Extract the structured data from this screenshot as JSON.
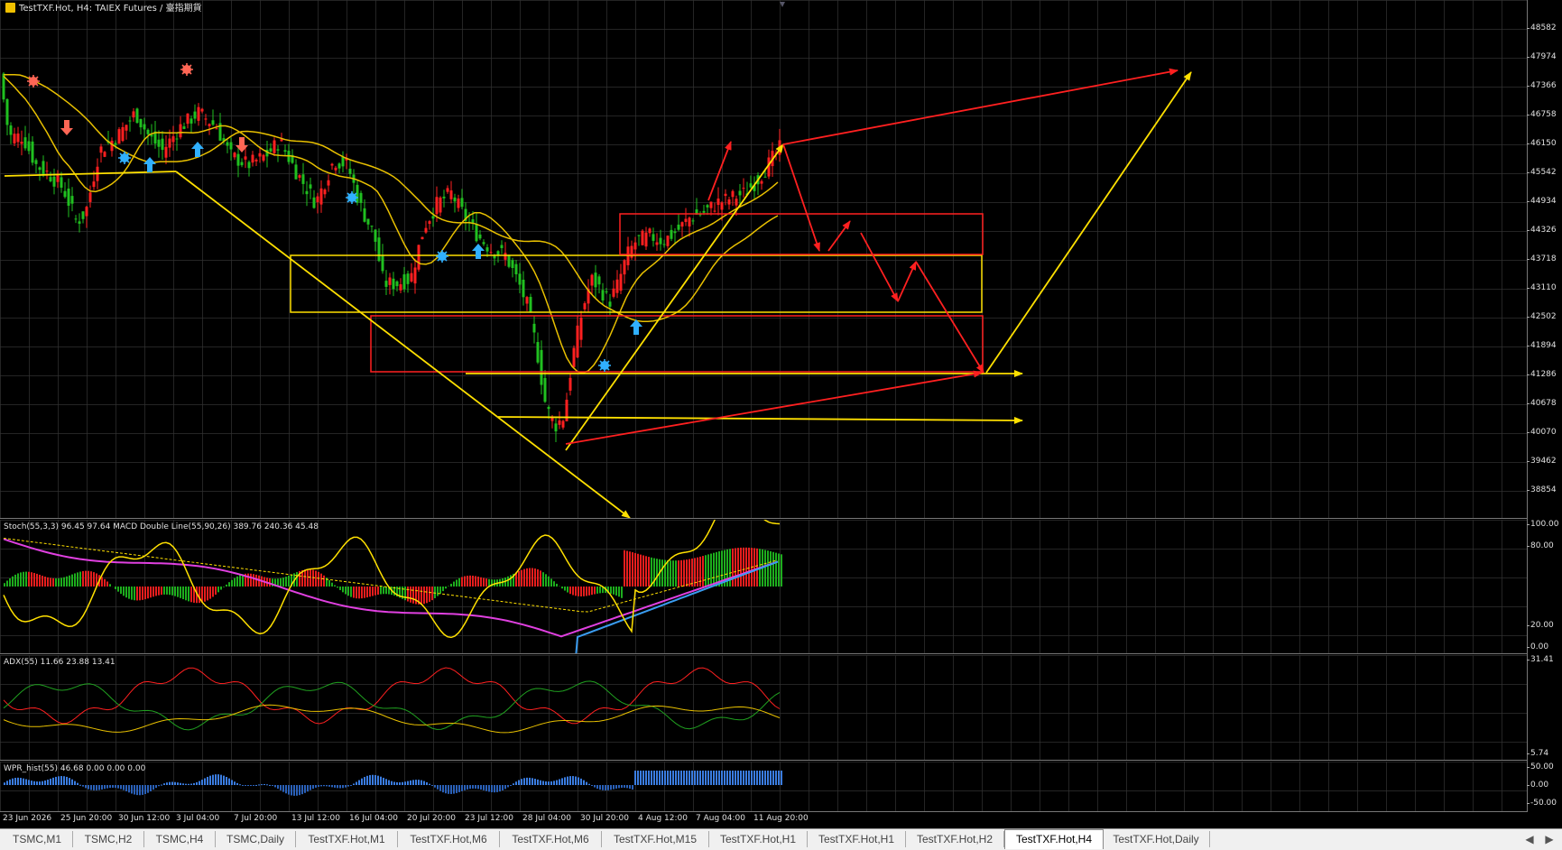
{
  "chart": {
    "title": "TestTXF.Hot, H4:  TAIEX Futures / 臺指期貨",
    "stoch_title": "Stoch(55,3,3) 96.45 97.64 MACD Double Line(55,90,26) 389.76 240.36 45.48",
    "adx_title": "ADX(55) 11.66 23.88 13.41",
    "wpr_title": "WPR_hist(55) 46.68 0.00 0.00 0.00"
  },
  "price_axis": [
    "48582",
    "47974",
    "47366",
    "46758",
    "46150",
    "45542",
    "44934",
    "44326",
    "43718",
    "43110",
    "42502",
    "41894",
    "41286",
    "40678",
    "40070",
    "39462",
    "38854"
  ],
  "stoch_axis": [
    "100.00",
    "80.00",
    "20.00",
    "0.00"
  ],
  "adx_axis": [
    "31.41",
    "5.74"
  ],
  "wpr_axis": [
    "50.00",
    "0.00",
    "-50.00"
  ],
  "time_axis": [
    "23 Jun 2026",
    "25 Jun 20:00",
    "30 Jun 12:00",
    "3 Jul 04:00",
    "7 Jul 20:00",
    "13 Jul 12:00",
    "16 Jul 04:00",
    "20 Jul 20:00",
    "23 Jul 12:00",
    "28 Jul 04:00",
    "30 Jul 20:00",
    "4 Aug 12:00",
    "7 Aug 04:00",
    "11 Aug 20:00"
  ],
  "tabs": [
    {
      "label": "TSMC,M1",
      "active": false
    },
    {
      "label": "TSMC,H2",
      "active": false
    },
    {
      "label": "TSMC,H4",
      "active": false
    },
    {
      "label": "TSMC,Daily",
      "active": false
    },
    {
      "label": "TestTXF.Hot,M1",
      "active": false
    },
    {
      "label": "TestTXF.Hot,M6",
      "active": false
    },
    {
      "label": "TestTXF.Hot,M6",
      "active": false
    },
    {
      "label": "TestTXF.Hot,M15",
      "active": false
    },
    {
      "label": "TestTXF.Hot,H1",
      "active": false
    },
    {
      "label": "TestTXF.Hot,H1",
      "active": false
    },
    {
      "label": "TestTXF.Hot,H2",
      "active": false
    },
    {
      "label": "TestTXF.Hot,H4",
      "active": true
    },
    {
      "label": "TestTXF.Hot,Daily",
      "active": false
    }
  ],
  "colors": {
    "bull": "#ff2020",
    "bear": "#20c020",
    "ma": "#e8c000",
    "drawing_red": "#ff2020",
    "drawing_yellow": "#ffe000",
    "macd_pink": "#e040e0",
    "macd_blue": "#3a9cf0"
  }
}
